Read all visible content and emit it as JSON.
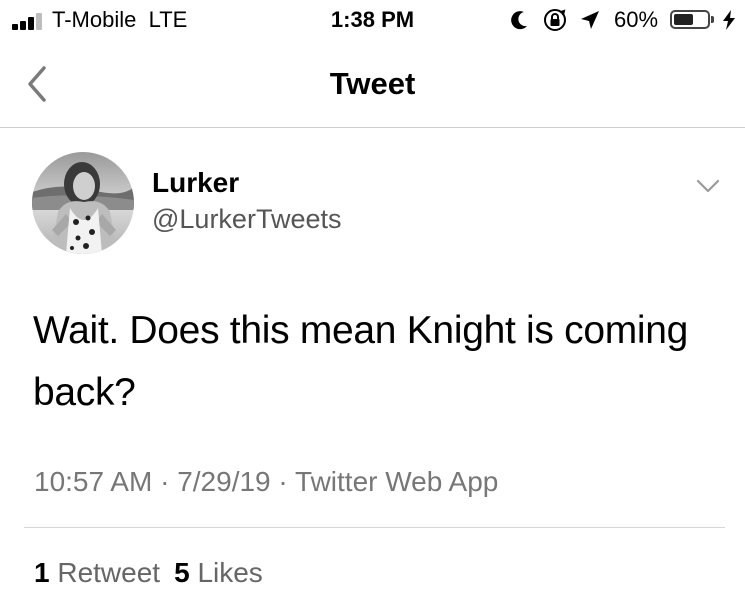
{
  "status_bar": {
    "carrier": "T-Mobile",
    "network": "LTE",
    "time": "1:38 PM",
    "battery_percent_label": "60%",
    "battery_level": 0.6,
    "signal_bars_active": 3,
    "signal_bars_total": 4,
    "icons": [
      "signal-icon",
      "moon-icon",
      "rotation-lock-icon",
      "location-arrow-icon",
      "battery-icon",
      "charging-bolt-icon"
    ]
  },
  "nav": {
    "title": "Tweet",
    "back_icon": "chevron-left-icon"
  },
  "tweet": {
    "author_name": "Lurker",
    "author_handle": "@LurkerTweets",
    "text": "Wait. Does this mean Knight is coming back?",
    "timestamp": "10:57 AM",
    "date": "7/29/19",
    "source": "Twitter Web App",
    "separator": "·",
    "more_icon": "chevron-down-icon"
  },
  "stats": {
    "retweets_count": "1",
    "retweets_label": "Retweet",
    "likes_count": "5",
    "likes_label": "Likes"
  },
  "colors": {
    "text_primary": "#000000",
    "text_secondary": "#777777",
    "divider": "#d8d8d8"
  }
}
